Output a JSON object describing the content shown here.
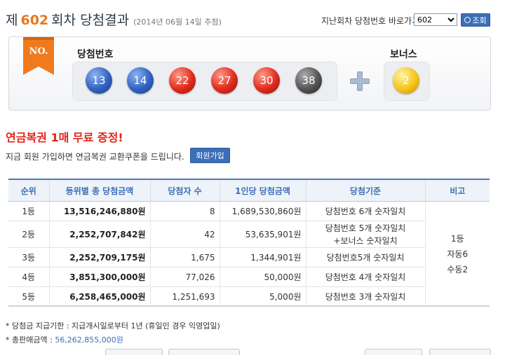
{
  "header": {
    "title_prefix": "제",
    "round": "602",
    "title_suffix": "회차 당첨결과",
    "draw_date": "(2014년 06월 14일 추첨)",
    "goto_label": "지난회차 당첨번호 바로가기",
    "round_select_value": "602",
    "search_label": "조회"
  },
  "draw": {
    "ribbon_text": "NO.",
    "winning_label": "당첨번호",
    "bonus_label": "보너스",
    "numbers": [
      "13",
      "14",
      "22",
      "27",
      "30",
      "38"
    ],
    "ball_colors": [
      "blue",
      "blue",
      "red",
      "red",
      "red",
      "dark"
    ],
    "bonus": "2",
    "bonus_color": "yellow",
    "colors": {
      "blue": "#2f63c1",
      "red": "#e12b1c",
      "dark": "#555555",
      "yellow": "#f5c518",
      "accent": "#3b6fb6",
      "promo": "#e2241a"
    }
  },
  "promo": {
    "title": "연금복권 1매 무료 증정!",
    "text": "지금 회원 가입하면 연금복권 교환쿠폰을 드립니다.",
    "join_label": "회원가입"
  },
  "table": {
    "headers": [
      "순위",
      "등위별 총 당첨금액",
      "당첨자 수",
      "1인당 당첨금액",
      "당첨기준",
      "비고"
    ],
    "rows": [
      {
        "rank": "1등",
        "total": "13,516,246,880원",
        "winners": "8",
        "per": "1,689,530,860원",
        "criteria": "당첨번호 6개 숫자일치",
        "criteria2": ""
      },
      {
        "rank": "2등",
        "total": "2,252,707,842원",
        "winners": "42",
        "per": "53,635,901원",
        "criteria": "당첨번호 5개 숫자일치",
        "criteria2": "+보너스 숫자일치"
      },
      {
        "rank": "3등",
        "total": "2,252,709,175원",
        "winners": "1,675",
        "per": "1,344,901원",
        "criteria": "당첨번호5개 숫자일치",
        "criteria2": ""
      },
      {
        "rank": "4등",
        "total": "3,851,300,000원",
        "winners": "77,026",
        "per": "50,000원",
        "criteria": "당첨번호 4개 숫자일치",
        "criteria2": ""
      },
      {
        "rank": "5등",
        "total": "6,258,465,000원",
        "winners": "1,251,693",
        "per": "5,000원",
        "criteria": "당첨번호 3개 숫자일치",
        "criteria2": ""
      }
    ],
    "note": [
      "1등",
      "자동6",
      "수동2"
    ]
  },
  "footer": {
    "deadline": "* 당첨금 지급기한 : 지급개시일로부터 1년 (휴일인 경우 익영업일)",
    "sales_label": "* 총판매금액 :",
    "sales_amount": "56,262,855,000원"
  }
}
